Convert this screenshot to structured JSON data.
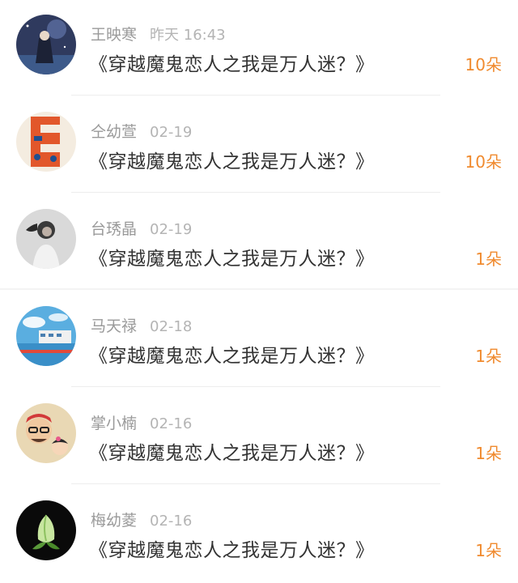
{
  "records": [
    {
      "name": "王映寒",
      "time": "昨天 16:43",
      "book": "《穿越魔鬼恋人之我是万人迷？》",
      "gift": "10朵",
      "avatar_icon": "night-sky-girl-avatar"
    },
    {
      "name": "仝幼萱",
      "time": "02-19",
      "book": "《穿越魔鬼恋人之我是万人迷？》",
      "gift": "10朵",
      "avatar_icon": "letter-e-avatar"
    },
    {
      "name": "台琇晶",
      "time": "02-19",
      "book": "《穿越魔鬼恋人之我是万人迷？》",
      "gift": "1朵",
      "avatar_icon": "portrait-woman-avatar"
    },
    {
      "name": "马天禄",
      "time": "02-18",
      "book": "《穿越魔鬼恋人之我是万人迷？》",
      "gift": "1朵",
      "avatar_icon": "seaside-building-avatar"
    },
    {
      "name": "掌小楠",
      "time": "02-16",
      "book": "《穿越魔鬼恋人之我是万人迷？》",
      "gift": "1朵",
      "avatar_icon": "man-and-child-avatar"
    },
    {
      "name": "梅幼菱",
      "time": "02-16",
      "book": "《穿越魔鬼恋人之我是万人迷？》",
      "gift": "1朵",
      "avatar_icon": "flower-bud-avatar"
    }
  ],
  "colors": {
    "gift_text": "#f08a2e",
    "name_text": "#9a9a9a",
    "time_text": "#b4b4b4",
    "title_text": "#333333"
  }
}
